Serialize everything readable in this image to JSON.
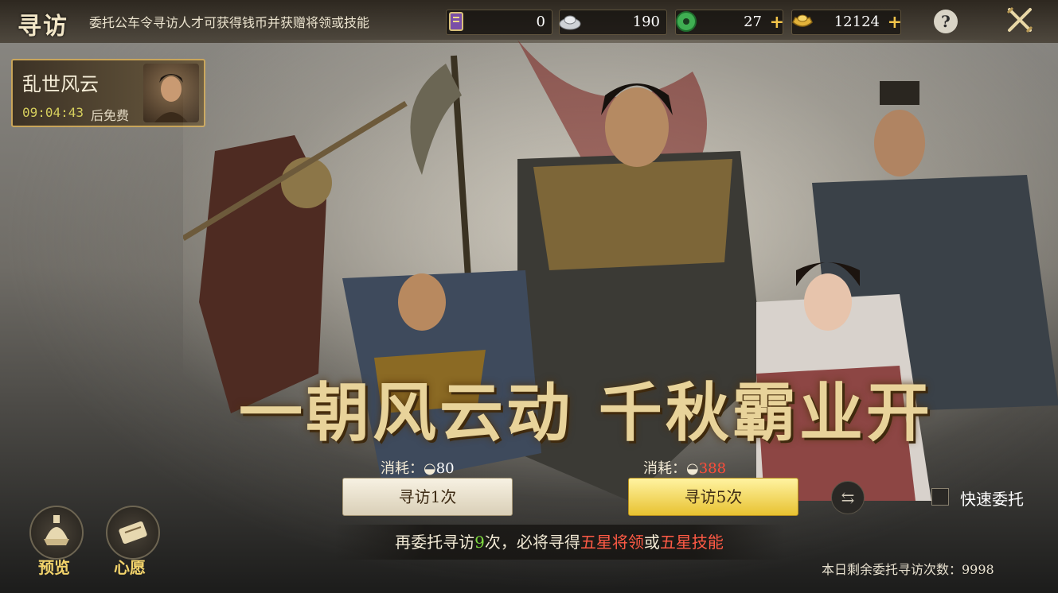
{
  "header": {
    "title": "寻访",
    "subtitle": "委托公车令寻访人才可获得钱币并获赠将领或技能",
    "resources": [
      {
        "icon": "scroll-ticket-icon",
        "value": "0"
      },
      {
        "icon": "silver-icon",
        "value": "190"
      },
      {
        "icon": "jade-icon",
        "value": "27",
        "plus": "+"
      },
      {
        "icon": "gold-ingot-icon",
        "value": "12124",
        "plus": "+"
      }
    ],
    "help_label": "?"
  },
  "event": {
    "name": "乱世风云",
    "timer": "09:04:43",
    "free_label": "后免费"
  },
  "slogan": "一朝风云动 千秋霸业开",
  "single": {
    "cost_label": "消耗：",
    "cost": "80",
    "button": "寻访1次"
  },
  "multi": {
    "cost_label": "消耗：",
    "cost": "388",
    "button": "寻访5次"
  },
  "quick": {
    "label": "快速委托"
  },
  "notice": {
    "pre": "再委托寻访",
    "count": "9",
    "mid": "次，必将寻得",
    "reward1": "五星将领",
    "or": "或",
    "reward2": "五星技能"
  },
  "remaining": "本日剩余委托寻访次数：9998",
  "side_buttons": [
    {
      "icon": "helmet-icon",
      "label": "预览"
    },
    {
      "icon": "scroll-icon",
      "label": "心愿"
    }
  ],
  "colors": {
    "accent": "#e8c231",
    "highlight_red": "#ff5a45",
    "highlight_green": "#7fdc3f"
  }
}
